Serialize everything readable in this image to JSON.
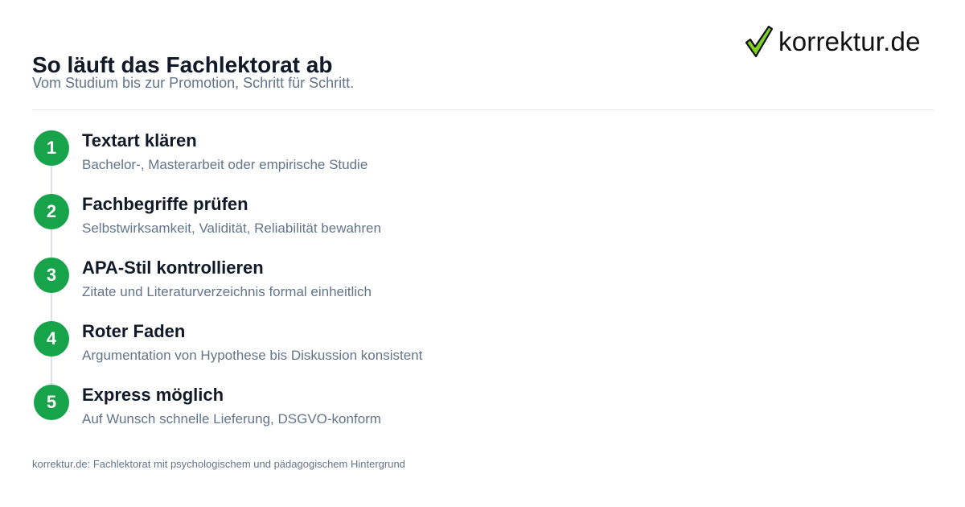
{
  "header": {
    "title": "So läuft das Fachlektorat ab",
    "subtitle": "Vom Studium bis zur Promotion, Schritt für Schritt."
  },
  "logo": {
    "text": "korrektur.de",
    "icon": "green-checkmark-icon",
    "colors": {
      "check_fill": "#7ed321",
      "check_outline": "#111111",
      "text": "#111111"
    }
  },
  "steps": [
    {
      "number": "1",
      "title": "Textart klären",
      "description": "Bachelor-, Masterarbeit oder empirische Studie"
    },
    {
      "number": "2",
      "title": "Fachbegriffe prüfen",
      "description": "Selbstwirksamkeit, Validität, Reliabilität bewahren"
    },
    {
      "number": "3",
      "title": "APA-Stil kontrollieren",
      "description": "Zitate und Literaturverzeichnis formal einheitlich"
    },
    {
      "number": "4",
      "title": "Roter Faden",
      "description": "Argumentation von Hypothese bis Diskussion konsistent"
    },
    {
      "number": "5",
      "title": "Express möglich",
      "description": "Auf Wunsch schnelle Lieferung, DSGVO-konform"
    }
  ],
  "footer": {
    "note": "korrektur.de: Fachlektorat mit psychologischem und pädagogischem Hintergrund"
  },
  "colors": {
    "accent": "#16a34a",
    "title_text": "#111827",
    "muted_text": "#64748b",
    "divider": "#e5e7eb",
    "timeline_line": "#dbe2ec"
  }
}
